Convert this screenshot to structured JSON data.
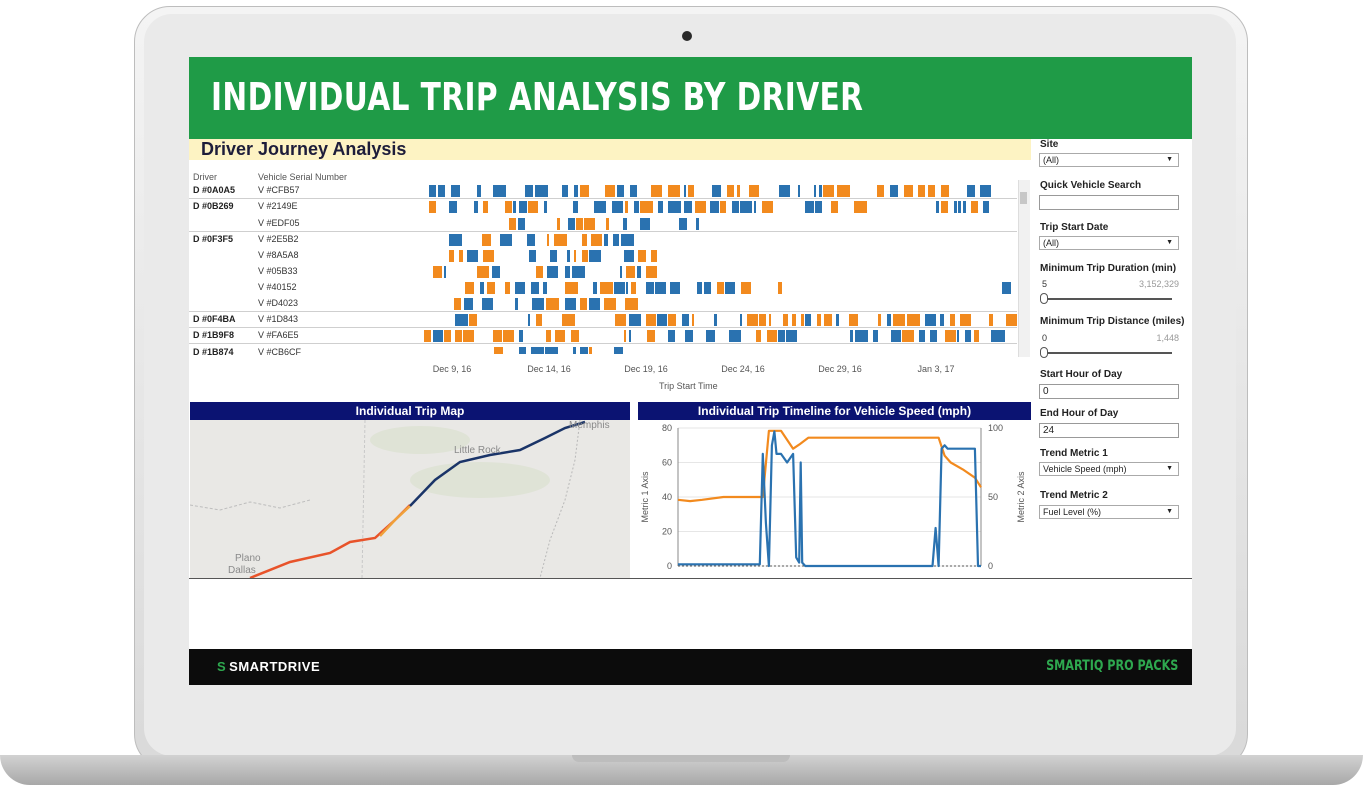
{
  "header": {
    "title": "INDIVIDUAL TRIP ANALYSIS BY DRIVER"
  },
  "section": {
    "title": "Driver Journey Analysis"
  },
  "table": {
    "col_driver": "Driver",
    "col_vehicle": "Vehicle Serial Number",
    "rows": [
      {
        "driver": "D #0A0A5",
        "vehicle": "V #CFB57"
      },
      {
        "driver": "D #0B269",
        "vehicle": "V #2149E"
      },
      {
        "driver": "",
        "vehicle": "V #EDF05"
      },
      {
        "driver": "D #0F3F5",
        "vehicle": "V #2E5B2"
      },
      {
        "driver": "",
        "vehicle": "V #8A5A8"
      },
      {
        "driver": "",
        "vehicle": "V #05B33"
      },
      {
        "driver": "",
        "vehicle": "V #40152"
      },
      {
        "driver": "",
        "vehicle": "V #D4023"
      },
      {
        "driver": "D #0F4BA",
        "vehicle": "V #1D843"
      },
      {
        "driver": "D #1B9F8",
        "vehicle": "V #FA6E5"
      },
      {
        "driver": "D #1B874",
        "vehicle": "V #CB6CF"
      }
    ],
    "x_ticks": [
      "Dec 9, 16",
      "Dec 14, 16",
      "Dec 19, 16",
      "Dec 24, 16",
      "Dec 29, 16",
      "Jan 3, 17"
    ],
    "x_label": "Trip Start Time"
  },
  "colors": {
    "header_green": "#1f9b47",
    "panel_navy": "#0b1372",
    "trip_orange": "#f28a1e",
    "trip_blue": "#2a72b0",
    "highlight_yellow": "#fdf3c3"
  },
  "map_panel": {
    "title": "Individual Trip Map",
    "labels": {
      "memphis": "Memphis",
      "little_rock": "Little Rock",
      "plano": "Plano",
      "dallas": "Dallas"
    }
  },
  "chart_data": {
    "type": "line",
    "title": "Individual Trip Timeline for Vehicle Speed (mph)",
    "ylabel": "Metric 1 Axis",
    "y2label": "Metric 2 Axis",
    "ylim": [
      0,
      80
    ],
    "y2lim": [
      0,
      100
    ],
    "y_ticks": [
      "80",
      "60",
      "40",
      "20",
      "0"
    ],
    "y2_ticks": [
      "100",
      "50",
      "0"
    ],
    "grid": true,
    "series": [
      {
        "color": "#f28a1e",
        "axis": "y2",
        "x": [
          0,
          4,
          8,
          15,
          20,
          28,
          30,
          32,
          34,
          38,
          40,
          43,
          48,
          52,
          60,
          70,
          80,
          86,
          88,
          90,
          94,
          98,
          100
        ],
        "values": [
          48,
          47,
          48,
          50,
          50,
          50,
          98,
          98,
          98,
          85,
          88,
          93,
          93,
          93,
          93,
          93,
          93,
          93,
          80,
          75,
          70,
          64,
          57
        ]
      },
      {
        "color": "#2a72b0",
        "axis": "y1",
        "x": [
          0,
          27,
          28,
          29,
          30,
          31,
          31.8,
          32.5,
          34,
          36,
          38,
          39,
          40,
          40.5,
          41,
          42,
          84,
          85,
          86,
          87,
          88,
          89,
          92,
          96,
          98,
          99,
          100
        ],
        "values": [
          1,
          1,
          65,
          25,
          0,
          70,
          78,
          65,
          65,
          60,
          65,
          5,
          2,
          60,
          2,
          0,
          0,
          22,
          0,
          68,
          70,
          68,
          68,
          68,
          68,
          0,
          0
        ]
      }
    ]
  },
  "sidebar": {
    "site_label": "Site",
    "site_value": "(All)",
    "quick_search_label": "Quick Vehicle Search",
    "quick_search_value": "",
    "trip_date_label": "Trip Start Date",
    "trip_date_value": "(All)",
    "min_duration_label": "Minimum Trip Duration (min)",
    "min_duration_min": "5",
    "min_duration_max": "3,152,329",
    "min_distance_label": "Minimum Trip Distance (miles)",
    "min_distance_min": "0",
    "min_distance_max": "1,448",
    "start_hour_label": "Start Hour of Day",
    "start_hour_value": "0",
    "end_hour_label": "End Hour of Day",
    "end_hour_value": "24",
    "trend1_label": "Trend Metric 1",
    "trend1_value": "Vehicle Speed (mph)",
    "trend2_label": "Trend Metric 2",
    "trend2_value": "Fuel Level (%)"
  },
  "footer": {
    "logo": "SMARTDRIVE",
    "brand": "SMARTIQ PRO PACKS"
  }
}
